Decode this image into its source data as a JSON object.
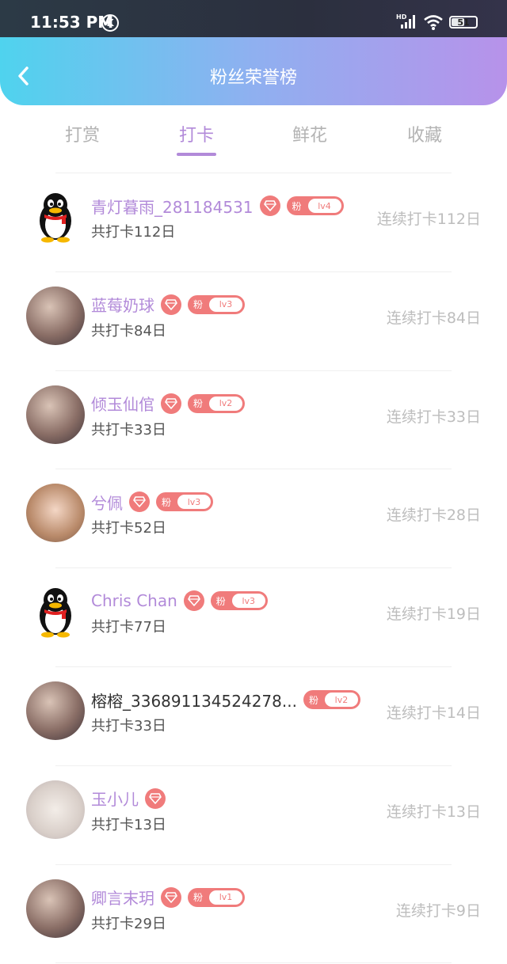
{
  "status_bar": {
    "time": "11:53 PM",
    "k_glyph": "K",
    "network": "HD",
    "battery": "51"
  },
  "header": {
    "title": "粉丝荣誉榜"
  },
  "tabs": [
    "打赏",
    "打卡",
    "鲜花",
    "收藏"
  ],
  "active_tab": "打卡",
  "fan_badge_label": "粉",
  "colors": {
    "accent": "#b28ad9",
    "badge": "#f07b7b",
    "header_start": "#4fd3ee",
    "header_end": "#b792ea"
  },
  "fans": [
    {
      "name": "青灯暮雨_281184531",
      "total": "共打卡112日",
      "streak": "连续打卡112日",
      "level": "lv4",
      "vip": true,
      "avatar": "qq-penguin-avatar"
    },
    {
      "name": "蓝莓奶球",
      "total": "共打卡84日",
      "streak": "连续打卡84日",
      "level": "lv3",
      "vip": true,
      "avatar": "photo-avatar"
    },
    {
      "name": "倾玉仙倌",
      "total": "共打卡33日",
      "streak": "连续打卡33日",
      "level": "lv2",
      "vip": true,
      "avatar": "photo-avatar"
    },
    {
      "name": "兮佩",
      "total": "共打卡52日",
      "streak": "连续打卡28日",
      "level": "lv3",
      "vip": true,
      "avatar": "anime-avatar"
    },
    {
      "name": "Chris Chan",
      "total": "共打卡77日",
      "streak": "连续打卡19日",
      "level": "lv3",
      "vip": true,
      "avatar": "qq-penguin-avatar"
    },
    {
      "name": "榕榕_336891134524278...",
      "total": "共打卡33日",
      "streak": "连续打卡14日",
      "level": "lv2",
      "vip": false,
      "avatar": "photo-avatar"
    },
    {
      "name": "玉小儿",
      "total": "共打卡13日",
      "streak": "连续打卡13日",
      "level": "",
      "vip": true,
      "avatar": "cat-avatar"
    },
    {
      "name": "卿言末玥",
      "total": "共打卡29日",
      "streak": "连续打卡9日",
      "level": "lv1",
      "vip": true,
      "avatar": "photo-avatar"
    }
  ]
}
